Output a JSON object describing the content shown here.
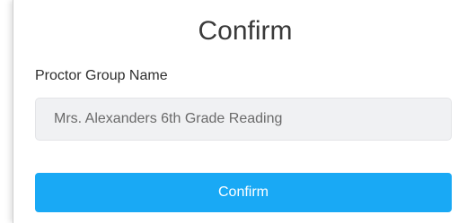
{
  "dialog": {
    "title": "Confirm",
    "field": {
      "label": "Proctor Group Name",
      "value": "Mrs. Alexanders 6th Grade Reading"
    },
    "confirm_label": "Confirm",
    "colors": {
      "button": "#19a9f5",
      "input_bg": "#f0f1f3"
    }
  }
}
